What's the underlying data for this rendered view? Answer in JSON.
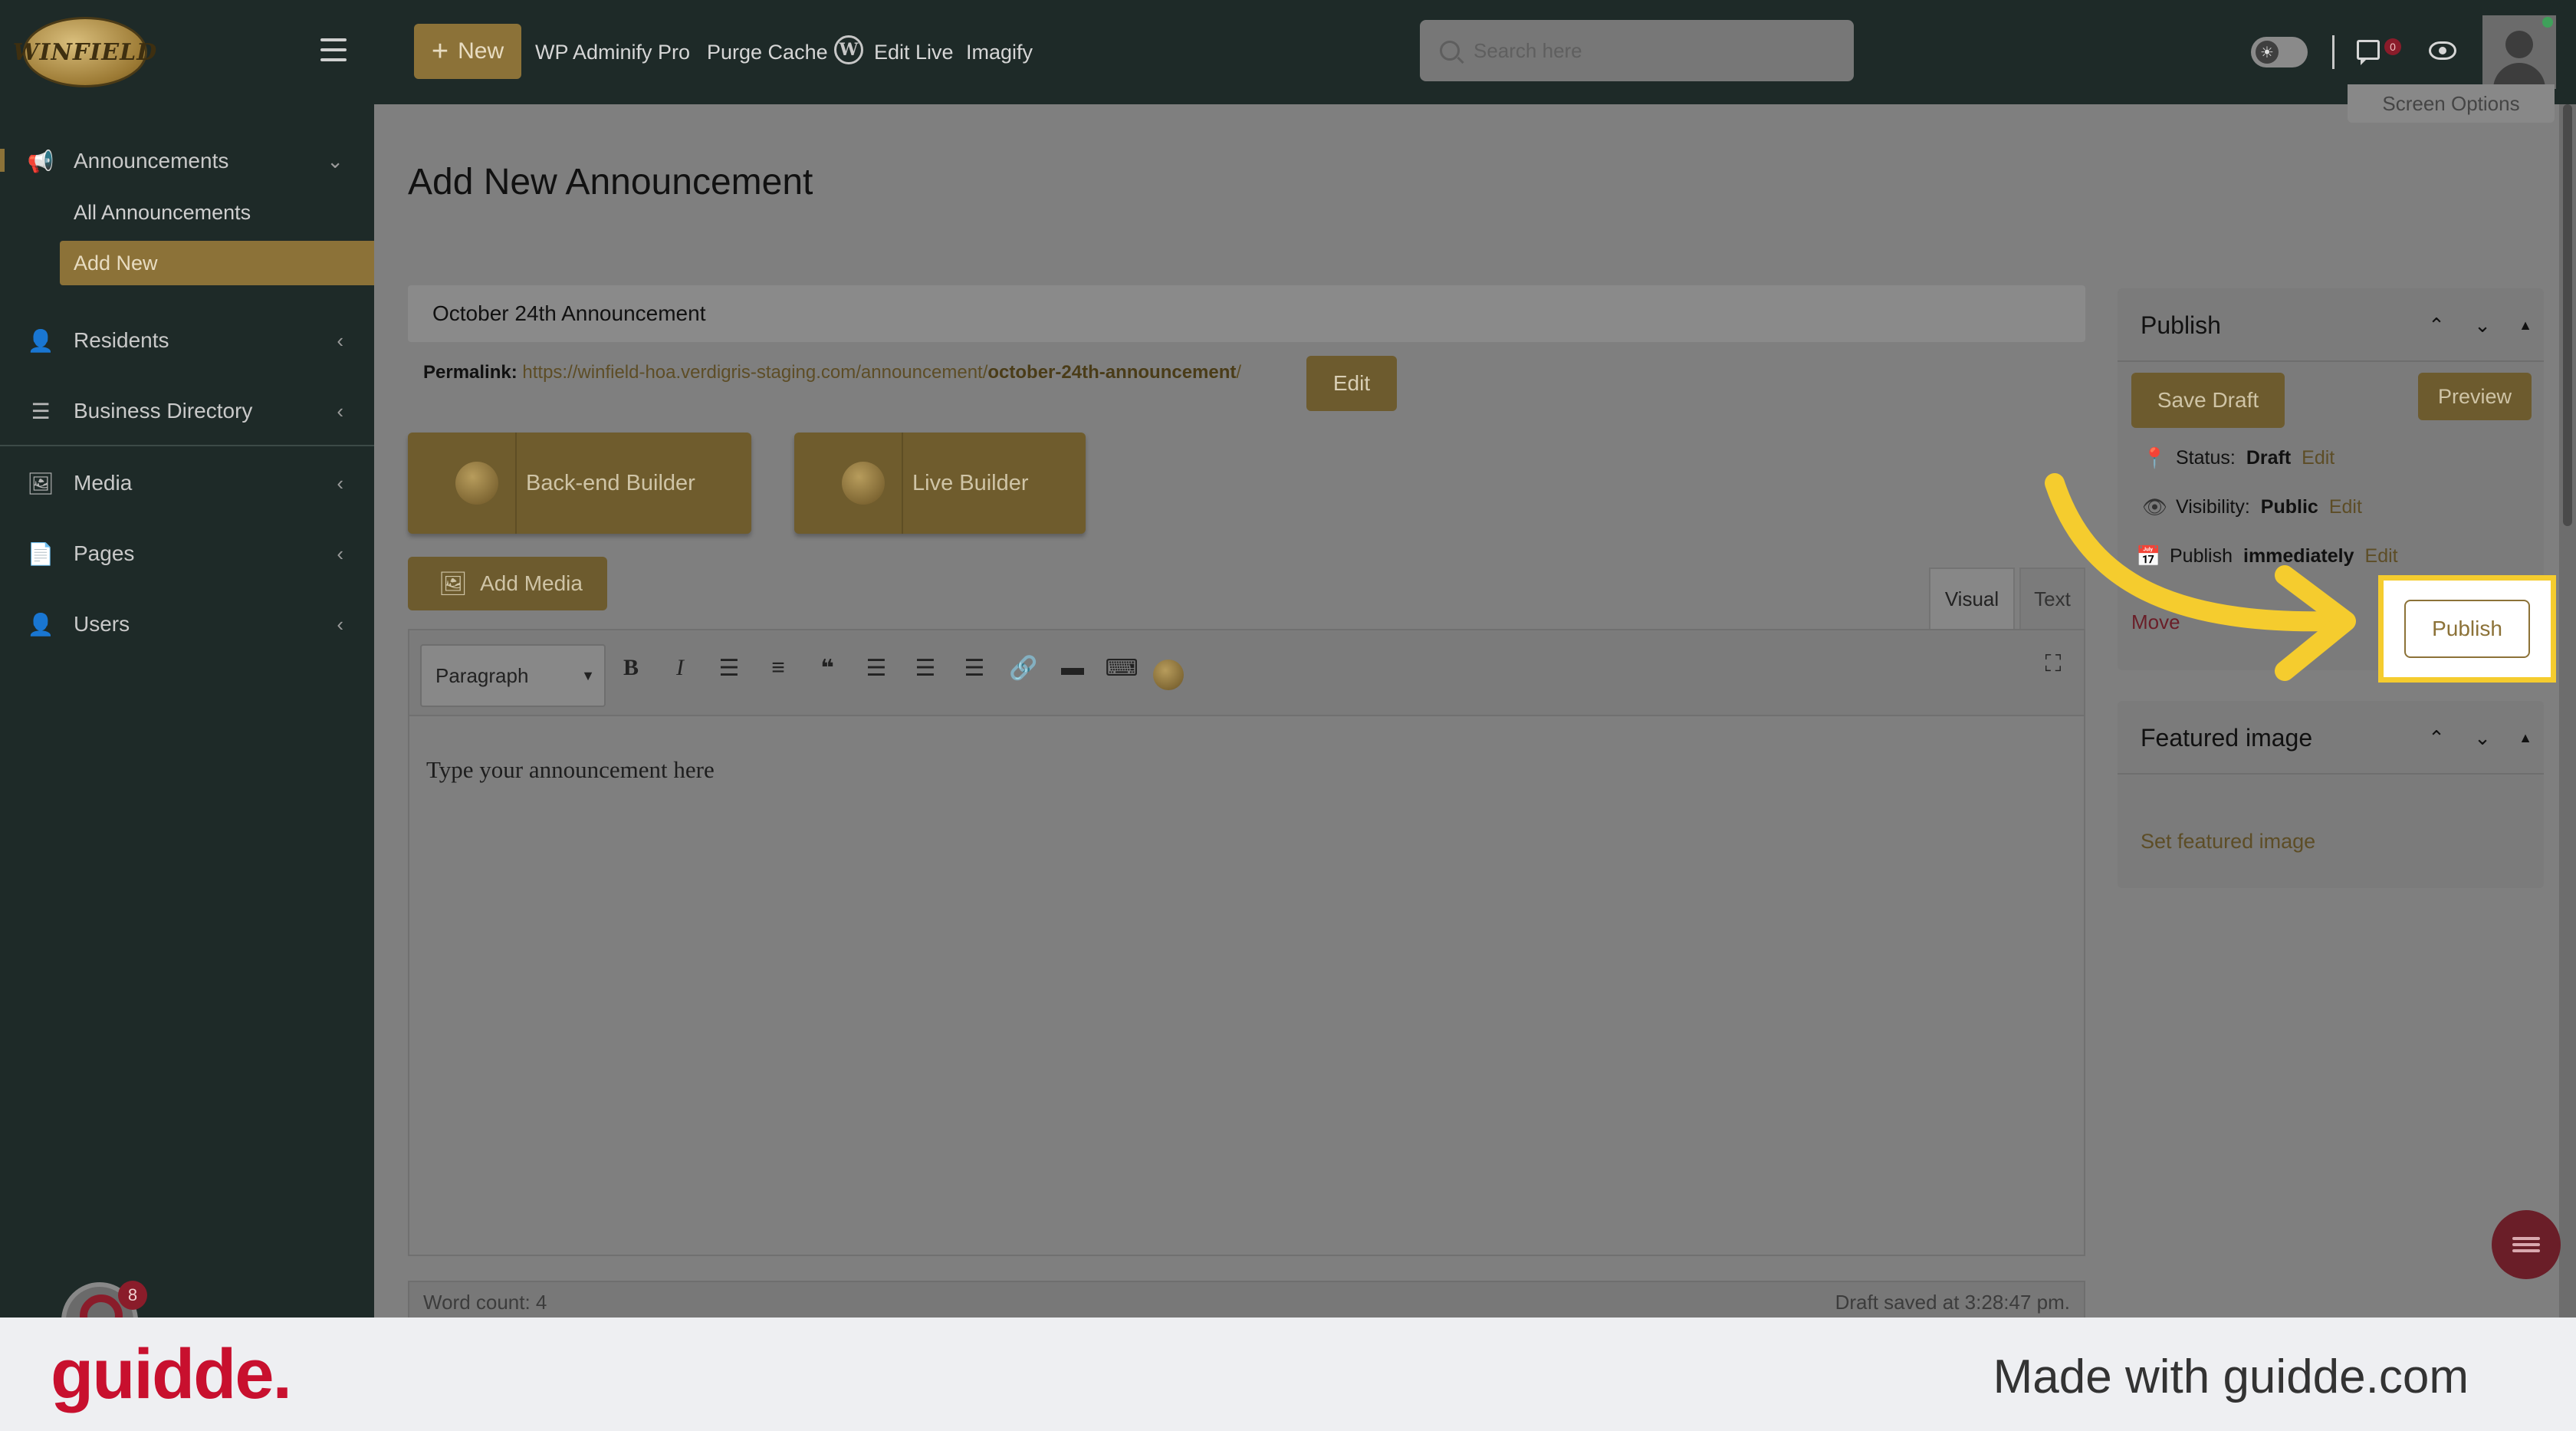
{
  "topbar": {
    "logo_text": "WINFIELD",
    "new_label": "New",
    "menu": [
      "WP Adminify Pro",
      "Purge Cache",
      "Edit Live",
      "Imagify"
    ],
    "search_placeholder": "Search here",
    "comments_count": "0"
  },
  "sidebar": {
    "items": [
      {
        "label": "Announcements",
        "icon": "megaphone-icon"
      },
      {
        "label": "Residents",
        "icon": "user-icon"
      },
      {
        "label": "Business Directory",
        "icon": "list-icon"
      },
      {
        "label": "Media",
        "icon": "media-icon"
      },
      {
        "label": "Pages",
        "icon": "pages-icon"
      },
      {
        "label": "Users",
        "icon": "user-icon"
      }
    ],
    "sub_items": [
      "All Announcements",
      "Add New"
    ],
    "guidde_badge": "8"
  },
  "main": {
    "screen_options": "Screen Options",
    "page_title": "Add New Announcement",
    "post_title": "October 24th Announcement",
    "permalink_label": "Permalink:",
    "permalink_url": "https://winfield-hoa.verdigris-staging.com/announcement/",
    "permalink_slug": "october-24th-announcement",
    "permalink_trail": "/",
    "edit_label": "Edit",
    "backend_builder": "Back-end Builder",
    "live_builder": "Live Builder",
    "add_media": "Add Media",
    "tab_visual": "Visual",
    "tab_text": "Text",
    "format_select": "Paragraph",
    "editor_placeholder": "Type your announcement here",
    "word_count": "Word count: 4",
    "draft_saved": "Draft saved at 3:28:47 pm."
  },
  "publish_panel": {
    "title": "Publish",
    "save_draft": "Save Draft",
    "preview": "Preview",
    "status_label": "Status:",
    "status_value": "Draft",
    "visibility_label": "Visibility:",
    "visibility_value": "Public",
    "publish_label": "Publish",
    "publish_value": "immediately",
    "edit": "Edit",
    "move_to_trash": "Move",
    "publish_button": "Publish"
  },
  "featured_panel": {
    "title": "Featured image",
    "set_link": "Set featured image"
  },
  "footer": {
    "brand": "guidde.",
    "made_with": "Made with guidde.com"
  },
  "colors": {
    "brand_gold": "#8c7238",
    "highlight": "#f5cc2e",
    "sidebar_bg": "#1e2a28",
    "guidde_red": "#c8102e"
  }
}
